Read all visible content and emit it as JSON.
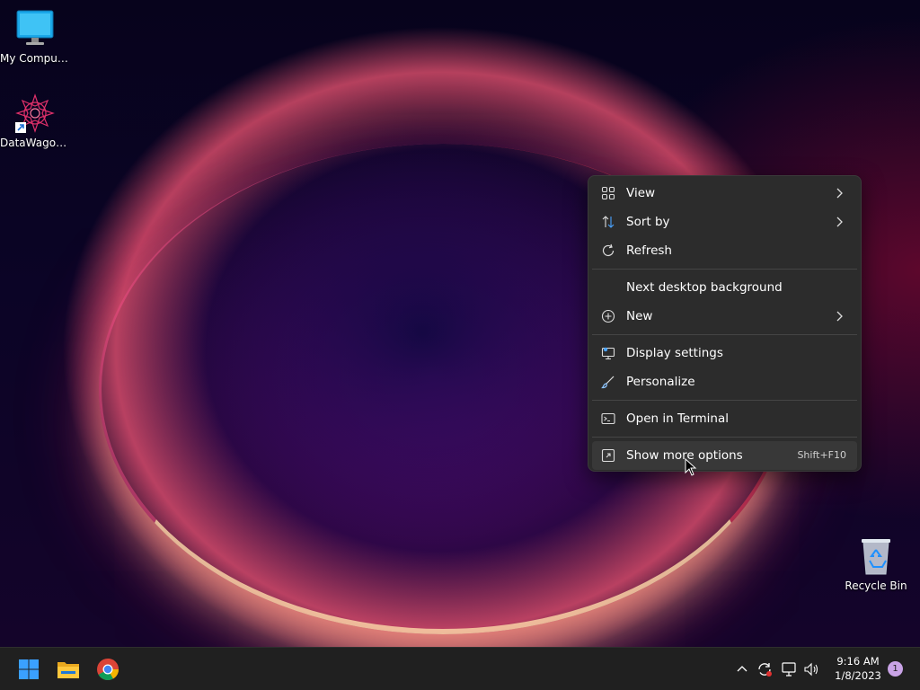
{
  "desktop": {
    "icons": [
      {
        "label": "My Computer",
        "icon": "monitor-icon"
      },
      {
        "label": "DataWagon...",
        "icon": "datawagon-shortcut-icon"
      },
      {
        "label": "Recycle Bin",
        "icon": "recycle-bin-icon"
      }
    ]
  },
  "context_menu": {
    "items": [
      {
        "label": "View",
        "icon": "grid-icon",
        "submenu": true
      },
      {
        "label": "Sort by",
        "icon": "sort-arrows-icon",
        "submenu": true
      },
      {
        "label": "Refresh",
        "icon": "refresh-icon"
      },
      {
        "label": "Next desktop background"
      },
      {
        "label": "New",
        "icon": "plus-circle-icon",
        "submenu": true
      },
      {
        "label": "Display settings",
        "icon": "display-settings-icon"
      },
      {
        "label": "Personalize",
        "icon": "brush-icon"
      },
      {
        "label": "Open in Terminal",
        "icon": "terminal-icon"
      },
      {
        "label": "Show more options",
        "icon": "expand-icon",
        "shortcut": "Shift+F10"
      }
    ]
  },
  "taskbar": {
    "apps": [
      {
        "name": "start",
        "icon": "windows-logo-icon"
      },
      {
        "name": "file-explorer",
        "icon": "folder-icon"
      },
      {
        "name": "chrome",
        "icon": "chrome-icon"
      }
    ],
    "tray": [
      "chevron-up-icon",
      "sync-icon",
      "network-icon",
      "volume-icon"
    ],
    "clock": {
      "time": "9:16 AM",
      "date": "1/8/2023"
    },
    "notification_count": "1"
  },
  "colors": {
    "menu_bg": "#2c2c2c",
    "menu_hover": "#383838",
    "taskbar_bg": "#202020",
    "accent": "#0a84ff"
  }
}
